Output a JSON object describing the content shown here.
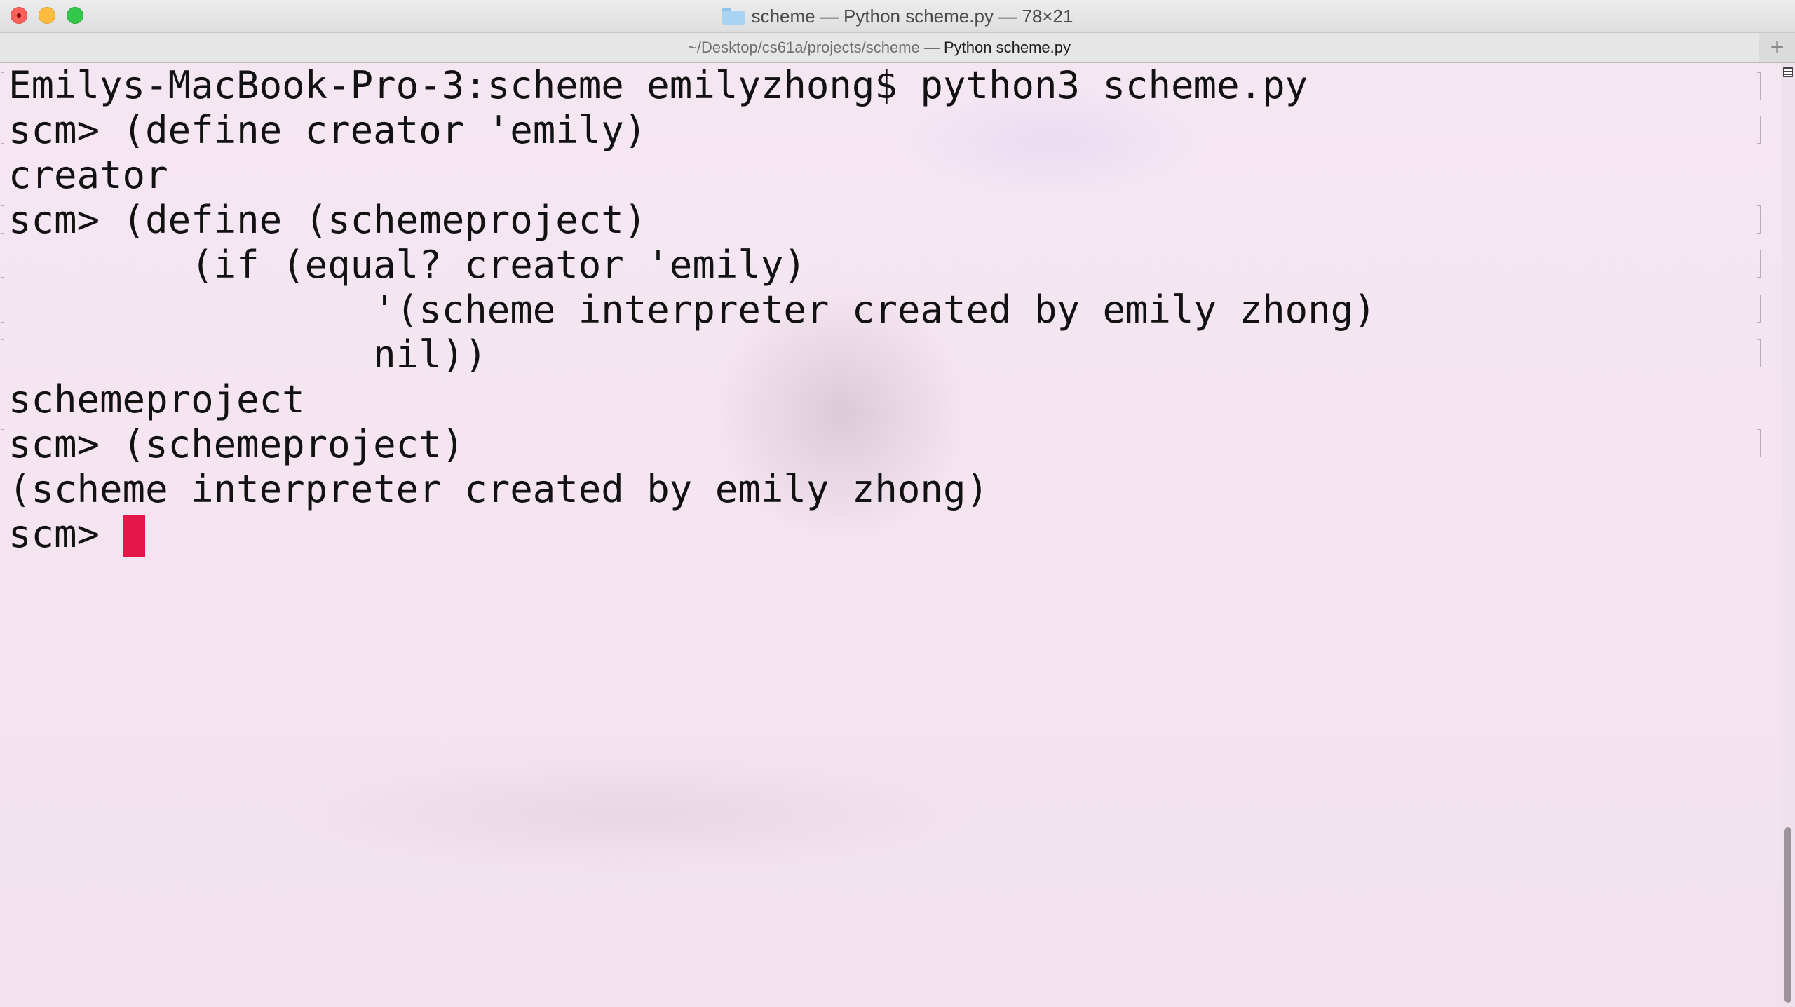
{
  "window": {
    "title": "scheme — Python scheme.py — 78×21",
    "icons": {
      "title_folder": "folder-icon",
      "new_tab": "plus-icon"
    },
    "colors": {
      "close": "#fc605b",
      "minimize": "#fdbc40",
      "zoom": "#34c84a"
    }
  },
  "tab": {
    "path": "~/Desktop/cs61a/projects/scheme — ",
    "name": "Python scheme.py",
    "new_tab_label": "+"
  },
  "terminal": {
    "background": "#f4e6f1",
    "cursor_color": "#e5174a",
    "lines": [
      "Emilys-MacBook-Pro-3:scheme emilyzhong$ python3 scheme.py",
      "scm> (define creator 'emily)",
      "creator",
      "scm> (define (schemeproject)",
      "        (if (equal? creator 'emily)",
      "                '(scheme interpreter created by emily zhong)",
      "                nil))",
      "schemeproject",
      "scm> (schemeproject)",
      "(scheme interpreter created by emily zhong)"
    ],
    "prompt": "scm> "
  }
}
